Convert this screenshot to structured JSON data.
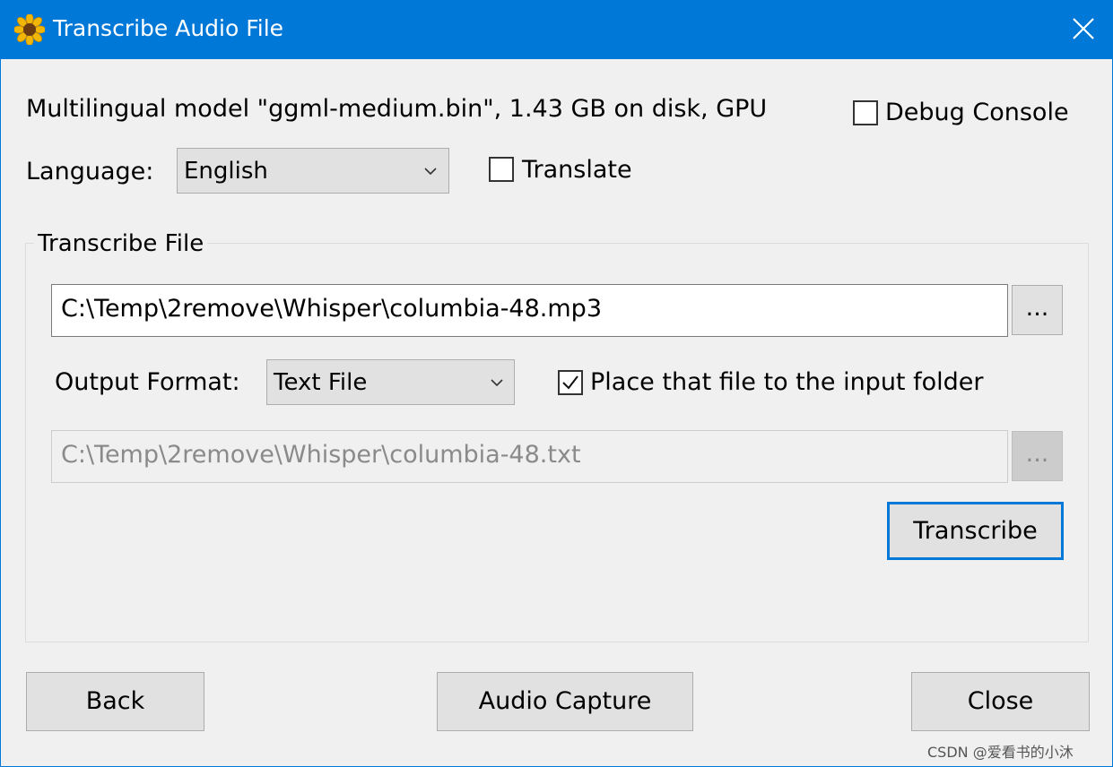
{
  "window": {
    "title": "Transcribe Audio File",
    "app_icon": "sunflower-icon",
    "close_icon": "close-icon",
    "accent_color": "#0078d7"
  },
  "model_info": "Multilingual model \"ggml-medium.bin\", 1.43 GB on disk, GPU",
  "debug_console": {
    "label": "Debug Console",
    "checked": false
  },
  "language": {
    "label": "Language:",
    "value": "English"
  },
  "translate": {
    "label": "Translate",
    "checked": false
  },
  "transcribe_group": {
    "title": "Transcribe File",
    "input_path": "C:\\Temp\\2remove\\Whisper\\columbia-48.mp3",
    "browse_input_label": "...",
    "output_format": {
      "label": "Output Format:",
      "value": "Text File"
    },
    "place_in_input_folder": {
      "label": "Place that file to the input folder",
      "checked": true
    },
    "output_path": "C:\\Temp\\2remove\\Whisper\\columbia-48.txt",
    "browse_output_label": "...",
    "transcribe_label": "Transcribe"
  },
  "footer": {
    "back_label": "Back",
    "audio_capture_label": "Audio Capture",
    "close_label": "Close"
  },
  "watermark": "CSDN @爱看书的小沐"
}
